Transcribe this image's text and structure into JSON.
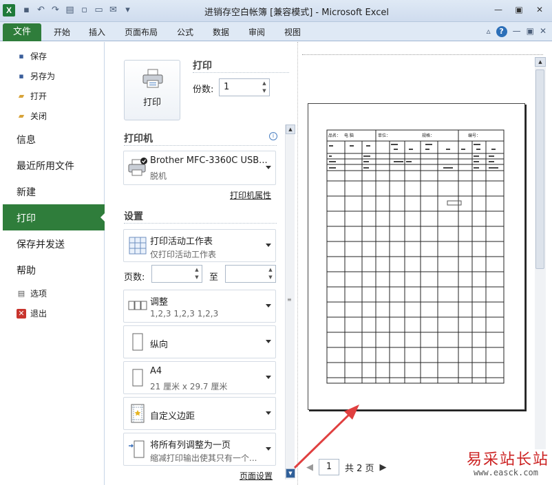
{
  "window": {
    "title": "进销存空白帐簿 [兼容模式] - Microsoft Excel",
    "app_icon": "X",
    "qat": [
      "save-icon",
      "undo-icon",
      "redo-icon",
      "print-preview-icon",
      "new-icon",
      "open-icon",
      "email-icon",
      "customize-qat-icon"
    ]
  },
  "ribbon": {
    "file_tab": "文件",
    "tabs": [
      "开始",
      "插入",
      "页面布局",
      "公式",
      "数据",
      "审阅",
      "视图"
    ]
  },
  "leftnav": {
    "save": "保存",
    "save_as": "另存为",
    "open": "打开",
    "close": "关闭",
    "info": "信息",
    "recent": "最近所用文件",
    "new": "新建",
    "print": "打印",
    "save_send": "保存并发送",
    "help": "帮助",
    "options": "选项",
    "exit": "退出"
  },
  "print": {
    "button_label": "打印",
    "heading": "打印",
    "copies_label": "份数:",
    "copies_value": "1",
    "printer_heading": "打印机",
    "printer_name": "Brother MFC-3360C USB...",
    "printer_status": "脱机",
    "printer_props": "打印机属性",
    "settings_heading": "设置",
    "what_title": "打印活动工作表",
    "what_sub": "仅打印活动工作表",
    "pages_label": "页数:",
    "to_label": "至",
    "collate_title": "调整",
    "collate_sub": "1,2,3    1,2,3    1,2,3",
    "orientation": "纵向",
    "paper_title": "A4",
    "paper_sub": "21 厘米 x 29.7 厘米",
    "margins": "自定义边距",
    "scaling_title": "将所有列调整为一页",
    "scaling_sub": "缩减打印输出使其只有一个...",
    "page_setup": "页面设置"
  },
  "preview": {
    "page_number": "1",
    "page_total": "共 2 页",
    "header_cells": [
      "品名：",
      "电 脑",
      "单位：",
      "规格：",
      "编号："
    ]
  },
  "watermark": {
    "text": "易采站长站",
    "url": "www.easck.com"
  }
}
